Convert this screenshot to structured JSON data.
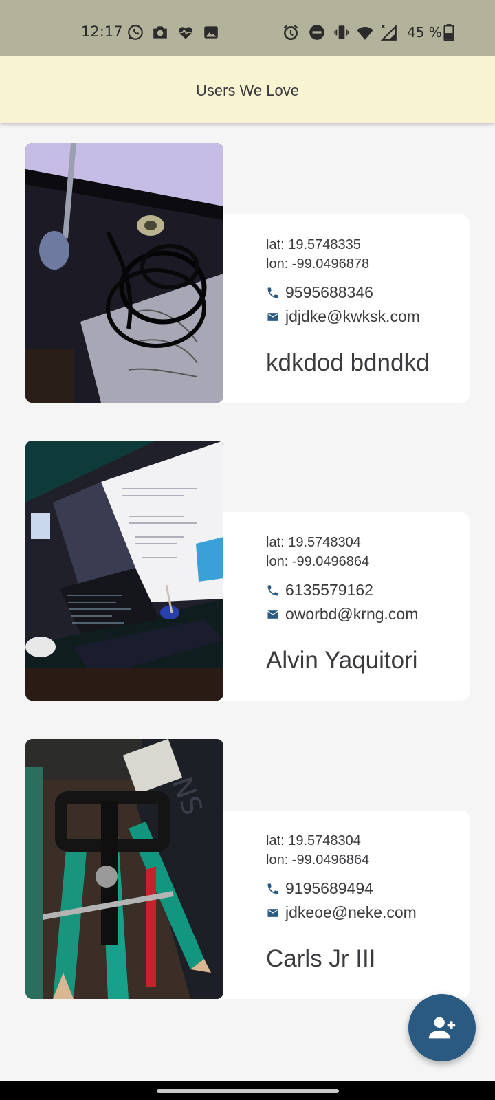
{
  "status_bar": {
    "time": "12:17",
    "battery_text": "45 %",
    "icons": [
      "whatsapp-icon",
      "camera-icon",
      "heart-pulse-icon",
      "image-icon",
      "alarm-icon",
      "do-not-disturb-icon",
      "vibrate-icon",
      "wifi-icon",
      "signal-icon",
      "battery-icon"
    ]
  },
  "app_bar": {
    "title": "Users We Love"
  },
  "users": [
    {
      "lat": "lat: 19.5748335",
      "lon": "lon: -99.0496878",
      "phone": "9595688346",
      "email": "jdjdke@kwksk.com",
      "name": "kdkdod bdndkd",
      "photo": "desk-cables-photo"
    },
    {
      "lat": "lat: 19.5748304",
      "lon": "lon: -99.0496864",
      "phone": "6135579162",
      "email": "oworbd@krng.com",
      "name": "Alvin Yaquitori",
      "photo": "laptop-screen-photo"
    },
    {
      "lat": "lat: 19.5748304",
      "lon": "lon: -99.0496864",
      "phone": "9195689494",
      "email": "jdkeoe@neke.com",
      "name": "Carls Jr III",
      "photo": "pencils-phone-holder-photo"
    }
  ],
  "fab": {
    "icon": "add-person-icon"
  },
  "colors": {
    "status_bar": "#b3b29a",
    "app_bar": "#f8f4d2",
    "background": "#f5f5f5",
    "accent": "#2a5a82",
    "text": "#3b3b3f"
  }
}
